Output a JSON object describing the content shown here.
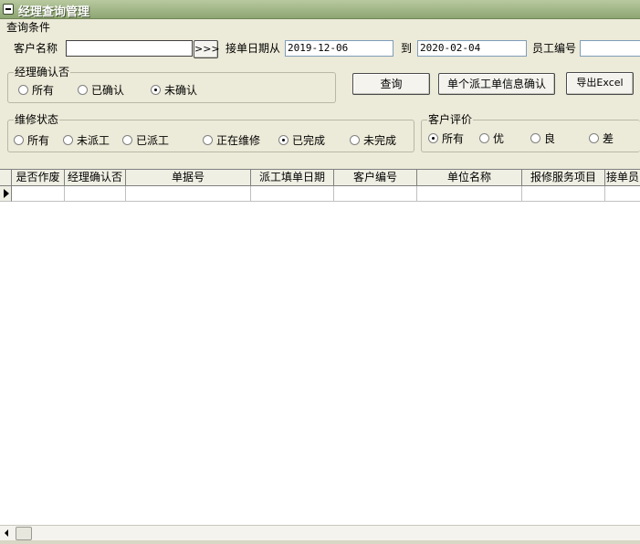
{
  "window": {
    "title": "经理查询管理"
  },
  "query_section": {
    "label": "查询条件"
  },
  "customer_name": {
    "label": "客户名称",
    "value": "",
    "browse_label": ">>>"
  },
  "date_range": {
    "from_label": "接单日期从",
    "from_value": "2019-12-06",
    "to_label": "到",
    "to_value": "2020-02-04"
  },
  "employee_no": {
    "label": "员工编号",
    "value": ""
  },
  "manager_confirm": {
    "title": "经理确认否",
    "options": [
      "所有",
      "已确认",
      "未确认"
    ],
    "selected": 2
  },
  "repair_status": {
    "title": "维修状态",
    "options": [
      "所有",
      "未派工",
      "已派工",
      "正在维修",
      "已完成",
      "未完成"
    ],
    "selected": 4
  },
  "customer_rating": {
    "title": "客户评价",
    "options": [
      "所有",
      "优",
      "良",
      "差"
    ],
    "selected": 0
  },
  "buttons": {
    "query": "查询",
    "confirm_single": "单个派工单信息确认",
    "export_excel": "导出Excel"
  },
  "grid": {
    "columns": [
      "是否作废",
      "经理确认否",
      "单据号",
      "派工填单日期",
      "客户编号",
      "单位名称",
      "报修服务项目",
      "接单员"
    ]
  }
}
